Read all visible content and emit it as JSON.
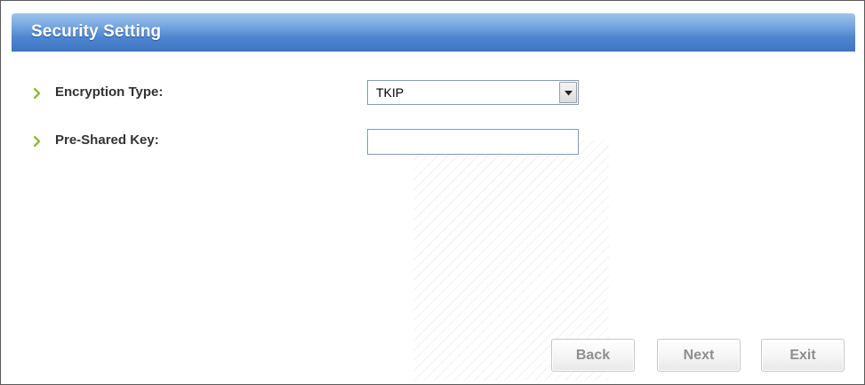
{
  "window": {
    "title": "Security Setting"
  },
  "form": {
    "encryption_type": {
      "label": "Encryption Type:",
      "selected": "TKIP",
      "icon": "chevron-right-icon"
    },
    "pre_shared_key": {
      "label": "Pre-Shared Key:",
      "value": "",
      "placeholder": "",
      "icon": "chevron-right-icon"
    }
  },
  "buttons": {
    "back": "Back",
    "next": "Next",
    "exit": "Exit"
  },
  "colors": {
    "title_bar": "#4e86d0",
    "bullet_arrow": "#8fbf2a",
    "button_text": "#8e8e8e"
  }
}
